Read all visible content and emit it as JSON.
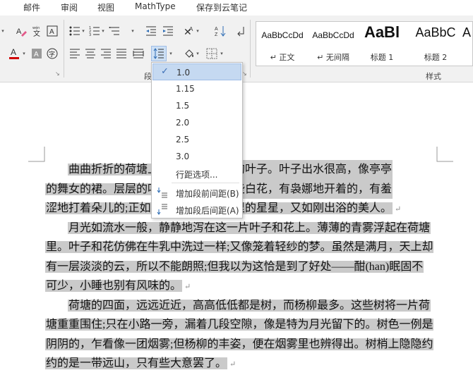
{
  "tabs": [
    "邮件",
    "审阅",
    "视图",
    "MathType",
    "保存到云笔记"
  ],
  "ribbon": {
    "styles_group_label": "样式",
    "paragraph_group_label": "段",
    "styles": [
      {
        "sample": "AaBbCcDd",
        "name": "↵ 正文"
      },
      {
        "sample": "AaBbCcDd",
        "name": "↵ 无间隔"
      },
      {
        "sample": "AaBl",
        "name": "标题 1"
      },
      {
        "sample": "AaBbC",
        "name": "标题 2"
      },
      {
        "sample": "A",
        "name": ""
      }
    ]
  },
  "line_spacing_menu": {
    "selected": "1.0",
    "options": [
      "1.0",
      "1.15",
      "1.5",
      "2.0",
      "2.5",
      "3.0"
    ],
    "line_spacing_options": "行距选项...",
    "add_space_before": "增加段前间距(B)",
    "add_space_after": "增加段后间距(A)"
  },
  "document": {
    "lines": [
      {
        "left": "曲曲折折的荷塘上",
        "right": "是田田的叶子。叶子出水很高，像亭亭",
        "mark": ""
      },
      {
        "left": "的舞女的裙。层层的叶",
        "right": "点缀着些白花，有袅娜地开着的，有羞",
        "mark": ""
      },
      {
        "left": "涩地打着朵儿的;正如一",
        "right": "如碧天里的星星，又如刚出浴的美人。",
        "mark": "↵"
      },
      {
        "left": "月光如流水一般，静静地泻在这一片叶子和花上。薄薄的青雾浮起在荷塘",
        "right": "",
        "mark": ""
      },
      {
        "left": "里。叶子和花仿佛在牛乳中洗过一样;又像笼着轻纱的梦。虽然是满月，天上却",
        "right": "",
        "mark": ""
      },
      {
        "left": "有一层淡淡的云，所以不能朗照;但我以为这恰是到了好处——酣(han)眠固不",
        "right": "",
        "mark": ""
      },
      {
        "left": "可少，小睡也别有风味的。",
        "right": "",
        "mark": "↵"
      },
      {
        "left": "荷塘的四面，远远近近，高高低低都是树，而杨柳最多。这些树将一片荷",
        "right": "",
        "mark": ""
      },
      {
        "left": "塘重重围住;只在小路一旁，漏着几段空隙，像是特为月光留下的。树色一例是",
        "right": "",
        "mark": ""
      },
      {
        "left": "阴阴的，乍看像一团烟雾;但杨柳的丰姿，便在烟雾里也辨得出。树梢上隐隐约",
        "right": "",
        "mark": ""
      },
      {
        "left": "约的是一带远山，只有些大意罢了。",
        "right": "",
        "mark": "↵"
      }
    ]
  },
  "colors": {
    "ribbon_bg": "#f1f1f1",
    "highlight": "#cacaca",
    "selected_item": "#c5d9f1",
    "font_color_red": "#d00000"
  }
}
